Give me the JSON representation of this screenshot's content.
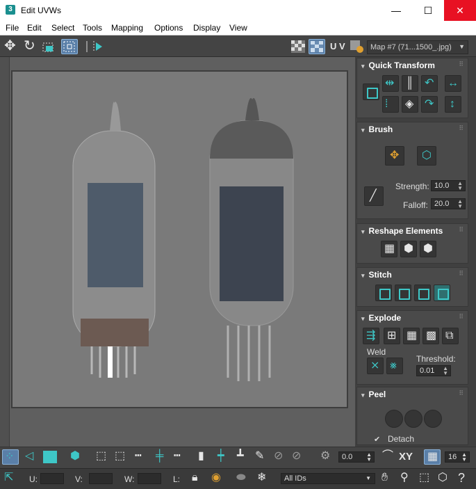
{
  "window": {
    "title": "Edit UVWs",
    "app_icon": "3",
    "controls": {
      "minimize": "—",
      "maximize": "☐",
      "close": "✕"
    }
  },
  "menu": [
    "File",
    "Edit",
    "Select",
    "Tools",
    "Mapping",
    "Options",
    "Display",
    "View"
  ],
  "toolbar": {
    "uv_label": "U V",
    "map_select": "Map #7 (71...1500_.jpg)"
  },
  "panels": {
    "quick_transform": {
      "title": "Quick Transform"
    },
    "brush": {
      "title": "Brush",
      "strength_label": "Strength:",
      "strength_value": "10.0",
      "falloff_label": "Falloff:",
      "falloff_value": "20.0"
    },
    "reshape": {
      "title": "Reshape Elements"
    },
    "stitch": {
      "title": "Stitch"
    },
    "explode": {
      "title": "Explode",
      "weld_label": "Weld",
      "threshold_label": "Threshold:",
      "threshold_value": "0.01"
    },
    "peel": {
      "title": "Peel",
      "detach_label": "Detach"
    }
  },
  "bottom": {
    "rotate_value": "0.0",
    "xy_label": "XY",
    "grid_value": "16",
    "u_label": "U:",
    "v_label": "V:",
    "w_label": "W:",
    "l_label": "L:",
    "ids_select": "All IDs"
  },
  "colors": {
    "accent": "#3ec7c7",
    "close": "#e81123",
    "panel": "#4a4a4a",
    "viewport": "#5f5f5f"
  }
}
